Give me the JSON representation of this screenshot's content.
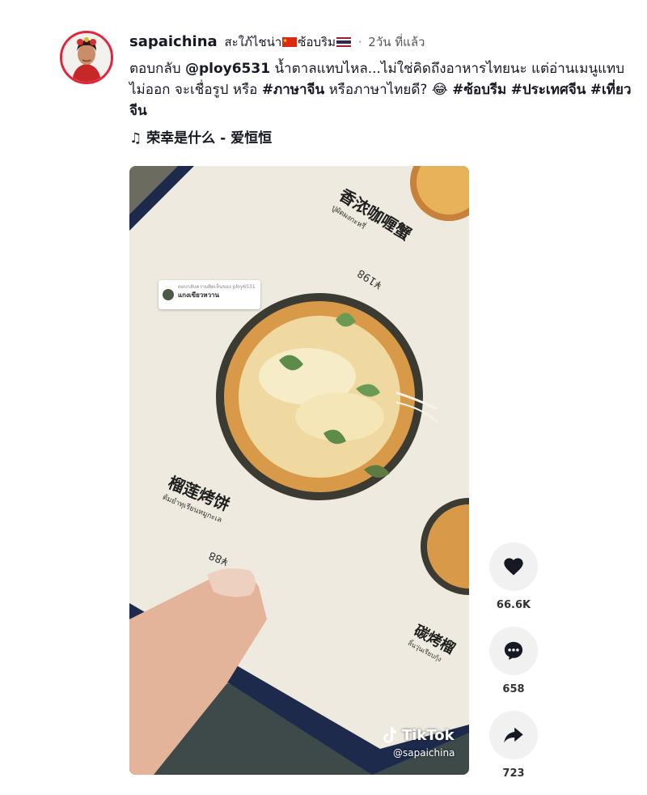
{
  "post": {
    "username": "sapaichina",
    "nickname_prefix": "สะใภ้ไชน่า",
    "nickname_suffix": "ซ้อบริม",
    "separator": "·",
    "time": "2วัน ที่แล้ว",
    "caption_reply_prefix": "ตอบกลับ",
    "caption_mention": "@ploy6531",
    "caption_text": "น้ำตาลแทบไหล...ไม่ใช่คิดถึงอาหารไทยนะ แต่อ่านเมนูแทบไม่ออก จะเชื่อรูป หรือ",
    "caption_tag1": "#ภาษาจีน",
    "caption_text2": "หรือภาษาไทยดี?",
    "caption_emoji": "😂",
    "caption_tag2": "#ซ้อบรีม",
    "caption_tag3": "#ประเทศจีน",
    "caption_tag4": "#เที่ยวจีน",
    "music_note": "♫",
    "music_title": "荣幸是什么 - 爱恒恒"
  },
  "video": {
    "reply_bubble_title": "ตอบกลับความคิดเห็นของ ploy6531",
    "reply_bubble_text": "แกงเขียวหวาน",
    "menu_top_chinese": "香浓咖喱蟹",
    "menu_top_thai": "ปูผัดผงกะหรี่",
    "menu_top_price_label": "198ร",
    "menu_top_price": "¥198",
    "menu_mid_chinese": "榴莲烤饼",
    "menu_mid_thai": "ต้มยำทุเรียนหมูกะเล",
    "menu_mid_price_label": "88ร",
    "menu_mid_price": "¥88",
    "menu_bottom_chinese": "碳烤榴",
    "menu_bottom_thai": "ลิ้นวุ่นเรียบกุ้ง",
    "watermark_brand": "TikTok",
    "watermark_handle": "@sapaichina"
  },
  "actions": {
    "likes": "66.6K",
    "comments": "658",
    "shares": "723"
  },
  "colors": {
    "accent": "#fe2c55",
    "menu_paper": "#efeae0",
    "menu_border": "#1d2a4c"
  }
}
